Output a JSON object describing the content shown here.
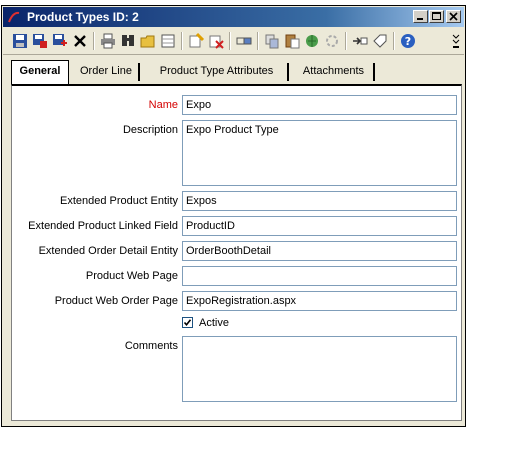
{
  "window": {
    "title": "Product Types ID: 2"
  },
  "toolbar": {
    "icons": [
      "save-icon",
      "save-copy-icon",
      "save-close-icon",
      "delete-icon",
      "print-icon",
      "find-icon",
      "open-folder-icon",
      "grid-icon",
      "wizard-icon",
      "cancel-wizard-icon",
      "link-icon",
      "copy-icon",
      "paste-icon",
      "refresh-globe-icon",
      "spinner-icon",
      "export-icon",
      "tag-icon",
      "help-icon"
    ]
  },
  "tabs": [
    {
      "label": "General",
      "active": true
    },
    {
      "label": "Order Line",
      "active": false
    },
    {
      "label": "Product Type Attributes",
      "active": false
    },
    {
      "label": "Attachments",
      "active": false
    }
  ],
  "form": {
    "name": {
      "label": "Name",
      "value": "Expo"
    },
    "description": {
      "label": "Description",
      "value": "Expo Product Type"
    },
    "extended_product_entity": {
      "label": "Extended Product Entity",
      "value": "Expos"
    },
    "extended_product_linked_field": {
      "label": "Extended Product Linked Field",
      "value": "ProductID"
    },
    "extended_order_detail_entity": {
      "label": "Extended Order Detail Entity",
      "value": "OrderBoothDetail"
    },
    "product_web_page": {
      "label": "Product Web Page",
      "value": ""
    },
    "product_web_order_page": {
      "label": "Product Web Order Page",
      "value": "ExpoRegistration.aspx"
    },
    "active": {
      "label": "Active",
      "checked": true
    },
    "comments": {
      "label": "Comments",
      "value": ""
    }
  },
  "colors": {
    "required_label": "#d40000",
    "title_bar": "#0a246a",
    "field_border": "#7f9db9"
  }
}
